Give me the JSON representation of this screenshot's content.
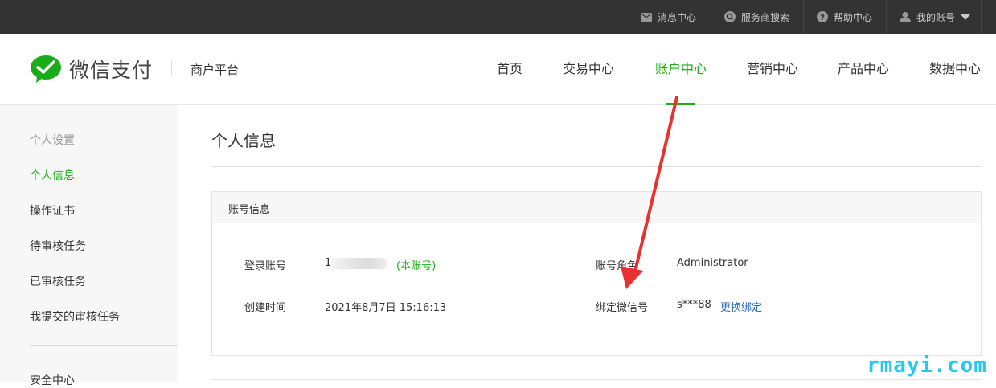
{
  "topbar": {
    "messages": "消息中心",
    "provider_search": "服务商搜索",
    "help": "帮助中心",
    "account": "我的账号"
  },
  "header": {
    "logo_text": "微信支付",
    "merchant_platform": "商户平台",
    "nav": [
      "首页",
      "交易中心",
      "账户中心",
      "营销中心",
      "产品中心",
      "数据中心"
    ],
    "active_nav": "账户中心"
  },
  "sidebar": {
    "section_personal": "个人设置",
    "items": [
      "个人信息",
      "操作证书",
      "待审核任务",
      "已审核任务",
      "我提交的审核任务"
    ],
    "section_security": "安全中心"
  },
  "main": {
    "page_title": "个人信息",
    "panel_title": "账号信息",
    "login_account_label": "登录账号",
    "login_account_value_prefix": "1",
    "login_account_suffix": "(本账号)",
    "created_label": "创建时间",
    "created_value": "2021年8月7日 15:16:13",
    "role_label": "账号角色",
    "role_value": "Administrator",
    "wechat_label": "绑定微信号",
    "wechat_value": "s***88",
    "change_binding": "更换绑定"
  },
  "watermark": "rmayi.com",
  "colors": {
    "accent": "#1aad19",
    "link": "#2a6bbd",
    "topbar": "#333333",
    "arrow": "#e8322f"
  }
}
